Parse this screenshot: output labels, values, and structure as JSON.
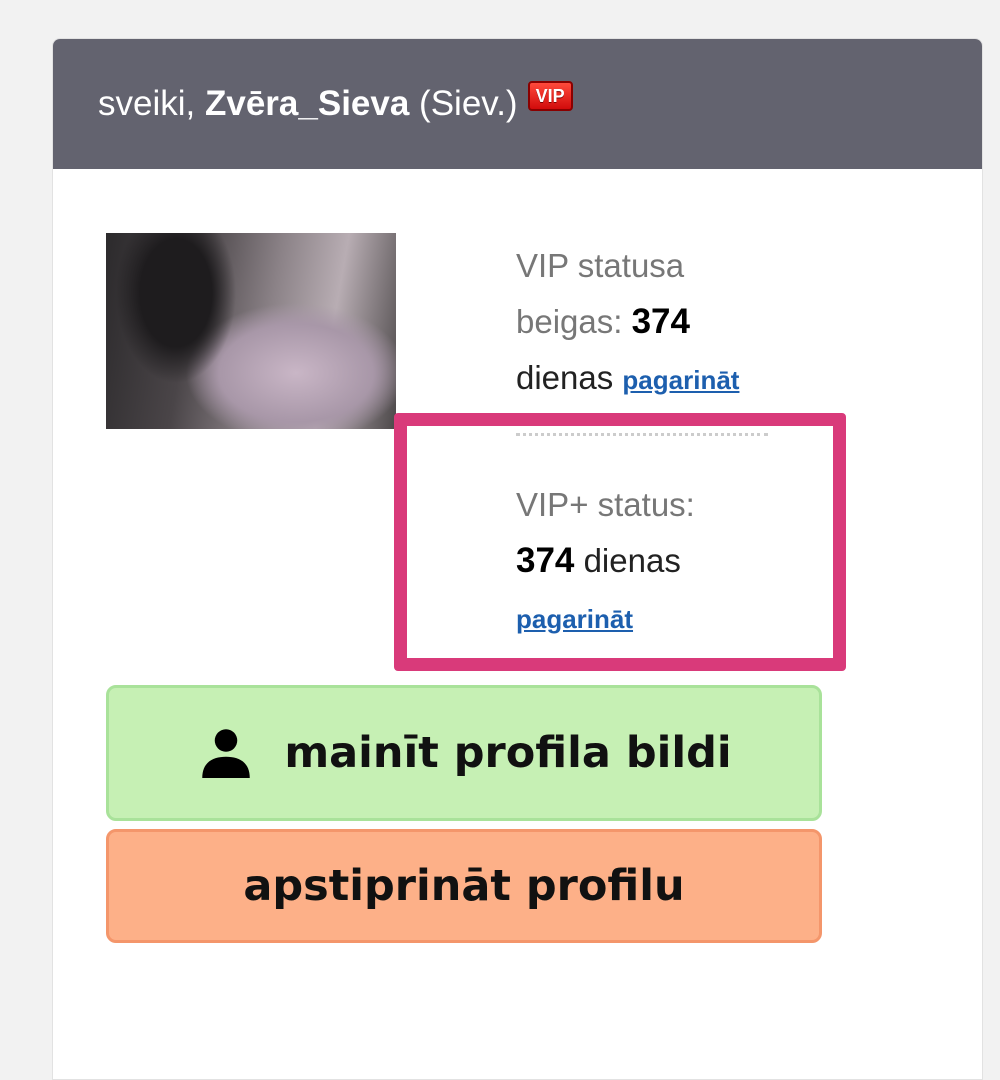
{
  "header": {
    "greeting": "sveiki,",
    "username": "Zvēra_Sieva",
    "gender": "(Siev.)",
    "badge": "VIP"
  },
  "vip": {
    "label_line1": "VIP statusa",
    "label_line2": "beigas:",
    "days_value": "374",
    "days_unit": "dienas",
    "extend_link": "pagarināt"
  },
  "vip_plus": {
    "label": "VIP+ status:",
    "days_value": "374",
    "days_unit": "dienas",
    "extend_link": "pagarināt"
  },
  "buttons": {
    "change_photo": "mainīt profila bildi",
    "confirm_profile": "apstiprināt profilu"
  },
  "colors": {
    "header_bg": "#63636f",
    "highlight_border": "#d93a7a",
    "link": "#1d5fae",
    "green_button": "#c6f0b4",
    "orange_button": "#fdb088"
  },
  "icons": {
    "change_photo": "person-icon"
  }
}
